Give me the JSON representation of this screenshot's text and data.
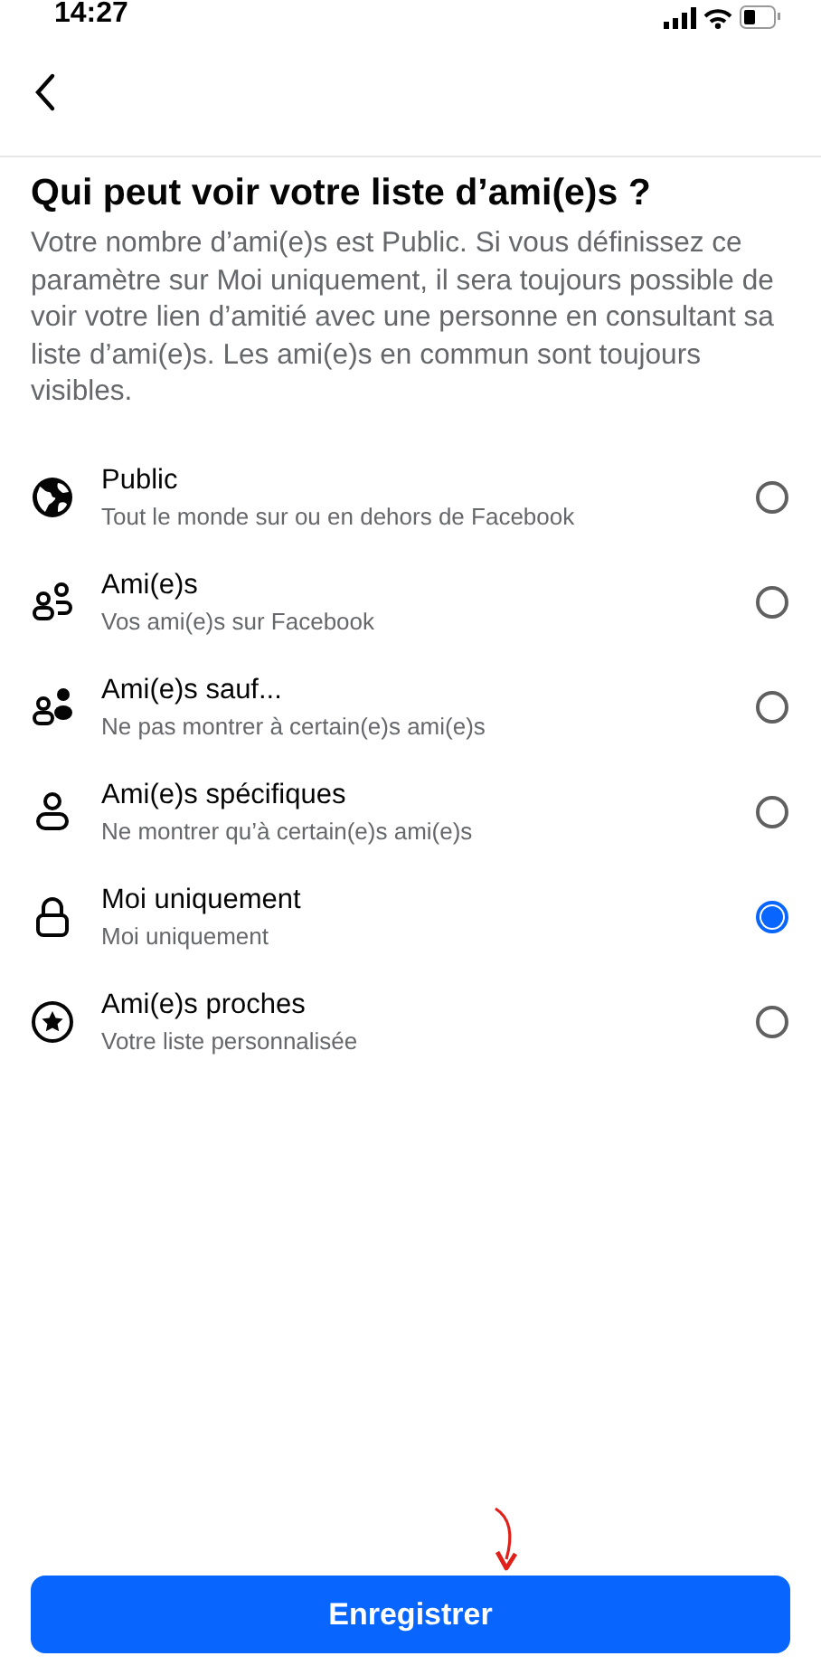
{
  "status_bar": {
    "time": "14:27"
  },
  "title": "Qui peut voir votre liste d’ami(e)s ?",
  "description": "Votre nombre d’ami(e)s est Public. Si vous définissez ce paramètre sur Moi uniquement, il sera toujours possible de voir votre lien d’amitié avec une personne en consultant sa liste d’ami(e)s. Les ami(e)s en commun sont toujours visibles.",
  "options": [
    {
      "kind": "globe",
      "label": "Public",
      "sublabel": "Tout le monde sur ou en dehors de Facebook",
      "selected": false
    },
    {
      "kind": "friends",
      "label": "Ami(e)s",
      "sublabel": "Vos ami(e)s sur Facebook",
      "selected": false
    },
    {
      "kind": "friends-except",
      "label": "Ami(e)s sauf...",
      "sublabel": "Ne pas montrer à certain(e)s ami(e)s",
      "selected": false
    },
    {
      "kind": "person",
      "label": "Ami(e)s spécifiques",
      "sublabel": "Ne montrer qu’à certain(e)s ami(e)s",
      "selected": false
    },
    {
      "kind": "lock",
      "label": "Moi uniquement",
      "sublabel": "Moi uniquement",
      "selected": true
    },
    {
      "kind": "star",
      "label": "Ami(e)s proches",
      "sublabel": "Votre liste personnalisée",
      "selected": false
    }
  ],
  "save_button": "Enregistrer"
}
